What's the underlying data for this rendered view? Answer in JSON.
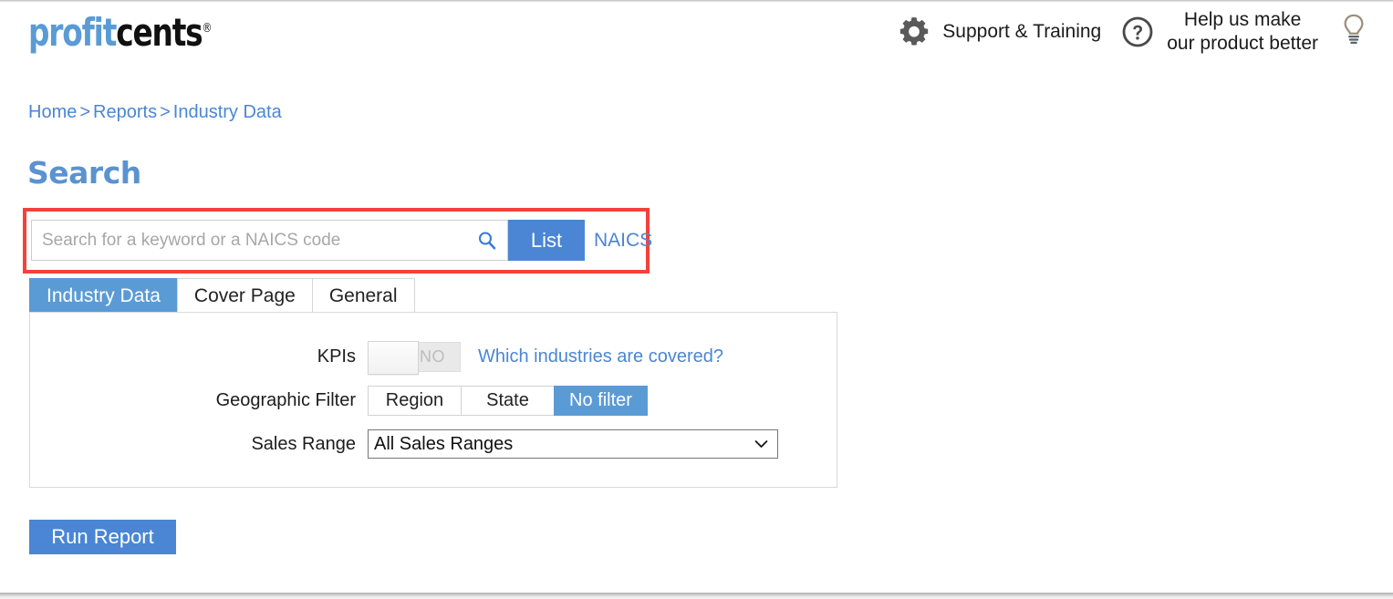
{
  "brand": {
    "logo_part1": "profit",
    "logo_part2": "cents",
    "logo_trademark": "®",
    "color_blue": "#5b9bd5",
    "color_black": "#111111"
  },
  "header": {
    "gear_icon": "gear-icon",
    "support_label": "Support & Training",
    "question_icon": "question-mark-circle-icon",
    "help_line1": "Help us make",
    "help_line2": "our product better",
    "bulb_icon": "lightbulb-icon"
  },
  "breadcrumb": {
    "items": [
      {
        "label": "Home"
      },
      {
        "label": "Reports"
      },
      {
        "label": "Industry Data"
      }
    ],
    "separator": ">"
  },
  "page": {
    "title": "Search"
  },
  "search": {
    "value": "",
    "placeholder": "Search for a keyword or a NAICS code",
    "search_icon": "magnifier-icon",
    "list_button": "List",
    "naics_link": "NAICS",
    "highlight_color": "#f4423a"
  },
  "tabs": [
    {
      "label": "Industry Data",
      "active": true
    },
    {
      "label": "Cover Page",
      "active": false
    },
    {
      "label": "General",
      "active": false
    }
  ],
  "form": {
    "kpis": {
      "label": "KPIs",
      "toggle_state": "NO",
      "covered_link": "Which industries are covered?"
    },
    "geographic_filter": {
      "label": "Geographic Filter",
      "options": [
        {
          "label": "Region",
          "active": false
        },
        {
          "label": "State",
          "active": false
        },
        {
          "label": "No filter",
          "active": true
        }
      ]
    },
    "sales_range": {
      "label": "Sales Range",
      "selected": "All Sales Ranges",
      "chevron_icon": "chevron-down-icon"
    }
  },
  "actions": {
    "run_report": "Run Report"
  }
}
